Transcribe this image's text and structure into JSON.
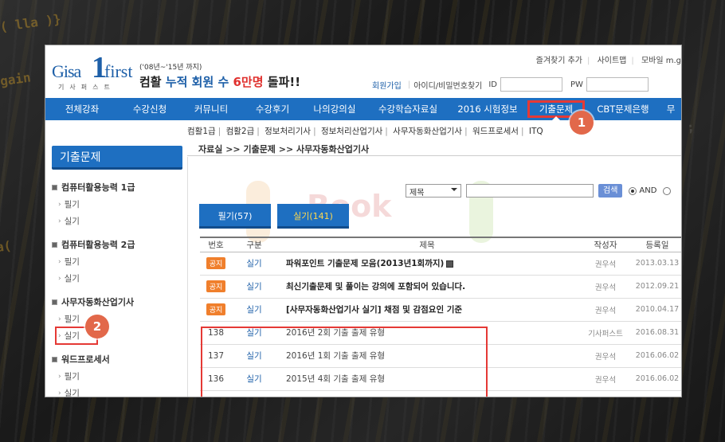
{
  "logo": {
    "gisa": "Gisa",
    "one": "1",
    "first": "first",
    "korean": "기사퍼스트"
  },
  "promo": {
    "small": "('08년~'15년 까지)",
    "pre": "컴활 ",
    "mid1": "누적 회원 수 ",
    "mid2": "6만명",
    "post": " 돌파!!"
  },
  "top_links": [
    "즐겨찾기 추가",
    "사이트맵",
    "모바일 m.g"
  ],
  "login": {
    "join": "회원가입",
    "find": "아이디/비밀번호찾기",
    "id_label": "ID",
    "pw_label": "PW"
  },
  "gnb": [
    {
      "label": "전체강좌"
    },
    {
      "label": "수강신청"
    },
    {
      "label": "커뮤니티"
    },
    {
      "label": "수강후기"
    },
    {
      "label": "나의강의실"
    },
    {
      "label": "수강학습자료실"
    },
    {
      "label": "2016 시험정보"
    },
    {
      "label": "기출문제"
    },
    {
      "label": "CBT문제은행"
    },
    {
      "label": "무"
    }
  ],
  "subnav": [
    "컴활1급",
    "컴활2급",
    "정보처리기사",
    "정보처리산업기사",
    "사무자동화산업기사",
    "워드프로세서",
    "ITQ"
  ],
  "callouts": {
    "one": "1",
    "two": "2"
  },
  "sidebar": {
    "title": "기출문제",
    "categories": [
      {
        "label": "컴퓨터활용능력 1급",
        "items": [
          "필기",
          "실기"
        ]
      },
      {
        "label": "컴퓨터활용능력 2급",
        "items": [
          "필기",
          "실기"
        ]
      },
      {
        "label": "사무자동화산업기사",
        "items": [
          "필기",
          "실기"
        ]
      },
      {
        "label": "워드프로세서",
        "items": [
          "필기",
          "실기"
        ]
      }
    ]
  },
  "breadcrumb": "자료실 >> 기출문제 >> 사무자동화산업기사",
  "watermark": "Book",
  "search": {
    "select_value": "제목",
    "button": "검색",
    "radio_and": "AND"
  },
  "tabs": [
    "필기(57)",
    "실기(141)"
  ],
  "table": {
    "headers": [
      "번호",
      "구분",
      "제목",
      "작성자",
      "등록일"
    ],
    "rows": [
      {
        "num": "공지",
        "kind": "실기",
        "title": "파워포인트 기출문제 모음(2013년1회까지)",
        "author": "권우석",
        "date": "2013.03.13"
      },
      {
        "num": "공지",
        "kind": "실기",
        "title": "최신기출문제 및 풀이는 강의에 포함되어 있습니다.",
        "author": "권우석",
        "date": "2012.09.21"
      },
      {
        "num": "공지",
        "kind": "실기",
        "title": "[사무자동화산업기사 실기] 채점 및 감점요인 기준",
        "author": "권우석",
        "date": "2010.04.17"
      },
      {
        "num": "138",
        "kind": "실기",
        "title": "2016년 2회 기출 출제 유형",
        "author": "기사퍼스트",
        "date": "2016.08.31"
      },
      {
        "num": "137",
        "kind": "실기",
        "title": "2016년 1회 기출 출제 유형",
        "author": "권우석",
        "date": "2016.06.02"
      },
      {
        "num": "136",
        "kind": "실기",
        "title": "2015년 4회 기출 출제 유형",
        "author": "권우석",
        "date": "2016.06.02"
      }
    ]
  },
  "colors": {
    "nav_blue": "#1e6fc1",
    "highlight_red": "#e53935",
    "callout": "#e2684a",
    "notice_badge": "#f07f2c"
  }
}
